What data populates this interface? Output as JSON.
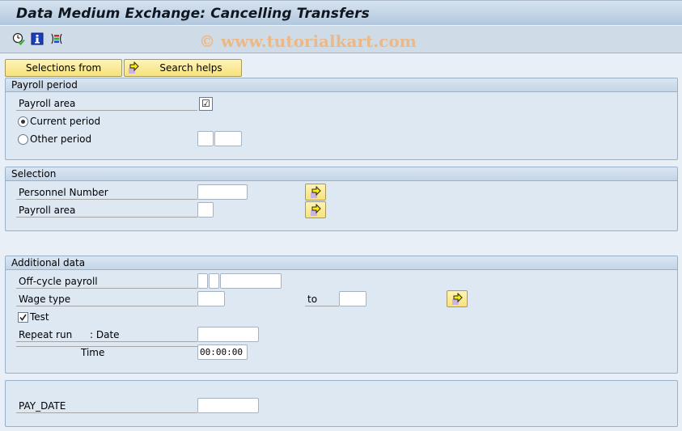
{
  "window": {
    "title": "Data Medium Exchange: Cancelling Transfers",
    "watermark": "© www.tutorialkart.com"
  },
  "toolbar": {
    "icons": [
      "execute-clock-icon",
      "info-icon",
      "program-documentation-icon"
    ]
  },
  "buttons": {
    "selections_from": "Selections from",
    "search_helps": "Search helps"
  },
  "payroll_period": {
    "header": "Payroll period",
    "payroll_area_label": "Payroll area",
    "payroll_area_value": "☑",
    "current_period_label": "Current period",
    "current_period_selected": true,
    "other_period_label": "Other period",
    "other_period_selected": false,
    "other_period_value_1": "",
    "other_period_value_2": ""
  },
  "selection": {
    "header": "Selection",
    "personnel_number_label": "Personnel Number",
    "personnel_number_value": "",
    "payroll_area_label": "Payroll area",
    "payroll_area_value": ""
  },
  "additional_data": {
    "header": "Additional data",
    "off_cycle_label": "Off-cycle payroll",
    "off_cycle_value_1": "",
    "off_cycle_value_2": "",
    "off_cycle_value_3": "",
    "wage_type_label": "Wage type",
    "wage_type_from": "",
    "to_label": "to",
    "wage_type_to": "",
    "test_label": "Test",
    "test_checked": true,
    "repeat_run_label": "Repeat run",
    "date_label": ": Date",
    "date_value": "",
    "time_label": "Time",
    "time_value": "00:00:00"
  },
  "pay_date": {
    "label": "PAY_DATE",
    "value": ""
  }
}
